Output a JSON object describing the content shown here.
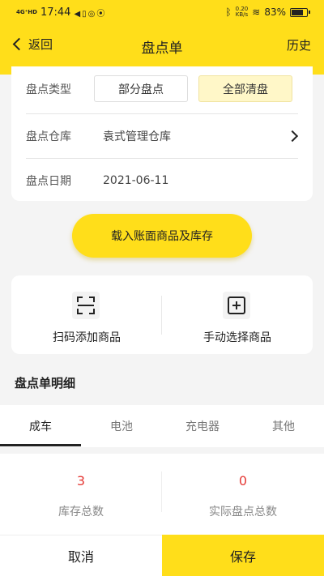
{
  "status_bar": {
    "network": "4G⁺HD",
    "time": "17:44",
    "speed_value": "0.20",
    "speed_unit": "KB/s",
    "battery_text": "83%",
    "battery_level": 0.83
  },
  "navbar": {
    "back_label": "返回",
    "title": "盘点单",
    "history_label": "历史"
  },
  "form": {
    "type_label": "盘点类型",
    "type_options": [
      "部分盘点",
      "全部清盘"
    ],
    "type_selected": "全部清盘",
    "warehouse_label": "盘点仓库",
    "warehouse_value": "袁式管理仓库",
    "date_label": "盘点日期",
    "date_value": "2021-06-11"
  },
  "load_button": "载入账面商品及库存",
  "actions": {
    "scan_label": "扫码添加商品",
    "manual_label": "手动选择商品"
  },
  "detail_section_title": "盘点单明细",
  "tabs": [
    "成车",
    "电池",
    "充电器",
    "其他"
  ],
  "active_tab": "成车",
  "summary": {
    "stock_total_value": "3",
    "stock_total_label": "库存总数",
    "actual_total_value": "0",
    "actual_total_label": "实际盘点总数"
  },
  "bottom": {
    "cancel_label": "取消",
    "save_label": "保存"
  },
  "colors": {
    "accent": "#ffde1a",
    "value_red": "#e53935",
    "background": "#f4f4f4"
  }
}
